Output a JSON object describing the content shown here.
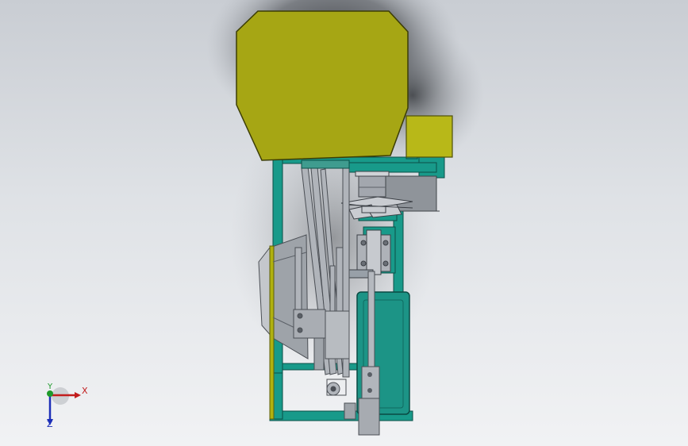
{
  "view": {
    "background_top": "#c9cdd3",
    "background_bottom": "#f1f2f4"
  },
  "model": {
    "colors": {
      "hopper": "#a6a614",
      "motor_box": "#b8b818",
      "frame": "#189a8a",
      "tank": "#1c9486",
      "steel": "#a3a7ae",
      "dark_steel": "#6e737a",
      "chute_panel": "#b0b10f"
    },
    "parts": [
      "hopper",
      "motor-box",
      "frame",
      "chute",
      "rods",
      "tank",
      "mechanism",
      "base-block"
    ]
  },
  "triad": {
    "x_label": "X",
    "y_label": "Y",
    "z_label": "Z",
    "x_color": "#c21d1d",
    "y_color": "#1e9a2b",
    "z_color": "#1d2fb8"
  }
}
